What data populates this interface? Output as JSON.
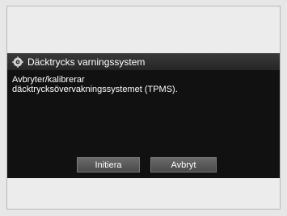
{
  "dialog": {
    "title": "Däcktrycks varningssystem",
    "title_icon": "tire-pressure-warning-icon",
    "message_line1": "Avbryter/kalibrerar",
    "message_line2": "däcktrycksövervakningssystemet (TPMS).",
    "buttons": {
      "initiate_label": "Initiera",
      "cancel_label": "Avbryt"
    }
  },
  "colors": {
    "background": "#e7e7e7",
    "dialog_bg": "#111111",
    "title_bar": "#2e2e2e",
    "button": "#5a5a5a",
    "text": "#ffffff"
  }
}
